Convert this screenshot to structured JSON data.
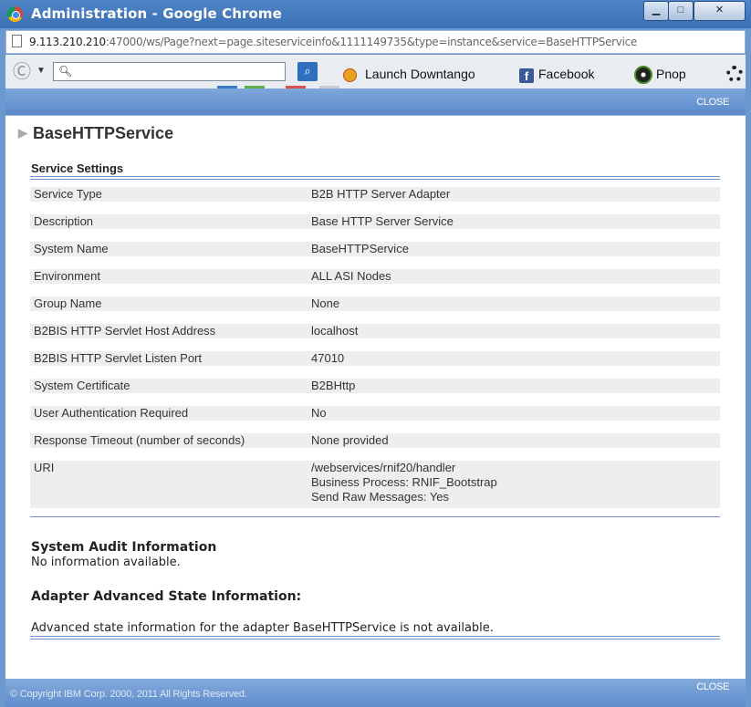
{
  "window": {
    "title": "Administration - Google Chrome",
    "minimize_icon": "minimize-icon",
    "maximize_icon": "maximize-icon",
    "close_icon": "close-icon"
  },
  "address": {
    "host": "9.113.210.210",
    "rest": ":47000/ws/Page?next=page.siteserviceinfo&1111149735&type=instance&service=BaseHTTPService"
  },
  "toolbar": {
    "search_placeholder": "",
    "launch_label": "Launch Downtango",
    "facebook_label": "Facebook",
    "facebook_glyph": "f",
    "pnop_label": "Pnop"
  },
  "dialog": {
    "close_top": "CLOSE",
    "close_bottom": "CLOSE",
    "service_name": "BaseHTTPService",
    "section_title": "Service Settings",
    "settings": [
      {
        "key": "Service Type",
        "value": "B2B HTTP Server Adapter"
      },
      {
        "key": "Description",
        "value": "Base HTTP Server Service"
      },
      {
        "key": "System Name",
        "value": "BaseHTTPService"
      },
      {
        "key": "Environment",
        "value": "ALL ASI Nodes"
      },
      {
        "key": "Group Name",
        "value": "None"
      },
      {
        "key": "B2BIS HTTP Servlet Host Address",
        "value": "localhost"
      },
      {
        "key": "B2BIS HTTP Servlet Listen Port",
        "value": "47010"
      },
      {
        "key": "System Certificate",
        "value": "B2BHttp"
      },
      {
        "key": "User Authentication Required",
        "value": "No"
      },
      {
        "key": "Response Timeout (number of seconds)",
        "value": "None provided"
      }
    ],
    "uri": {
      "key": "URI",
      "lines": [
        "/webservices/rnif20/handler",
        "Business Process: RNIF_Bootstrap",
        "Send Raw Messages: Yes"
      ]
    },
    "audit_title": "System Audit Information",
    "audit_text": "No information available.",
    "advanced_title": "Adapter Advanced State Information:",
    "advanced_text": "Advanced state information for the adapter BaseHTTPService is not available.",
    "copyright": "© Copyright IBM Corp. 2000, 2011 All Rights Reserved."
  }
}
